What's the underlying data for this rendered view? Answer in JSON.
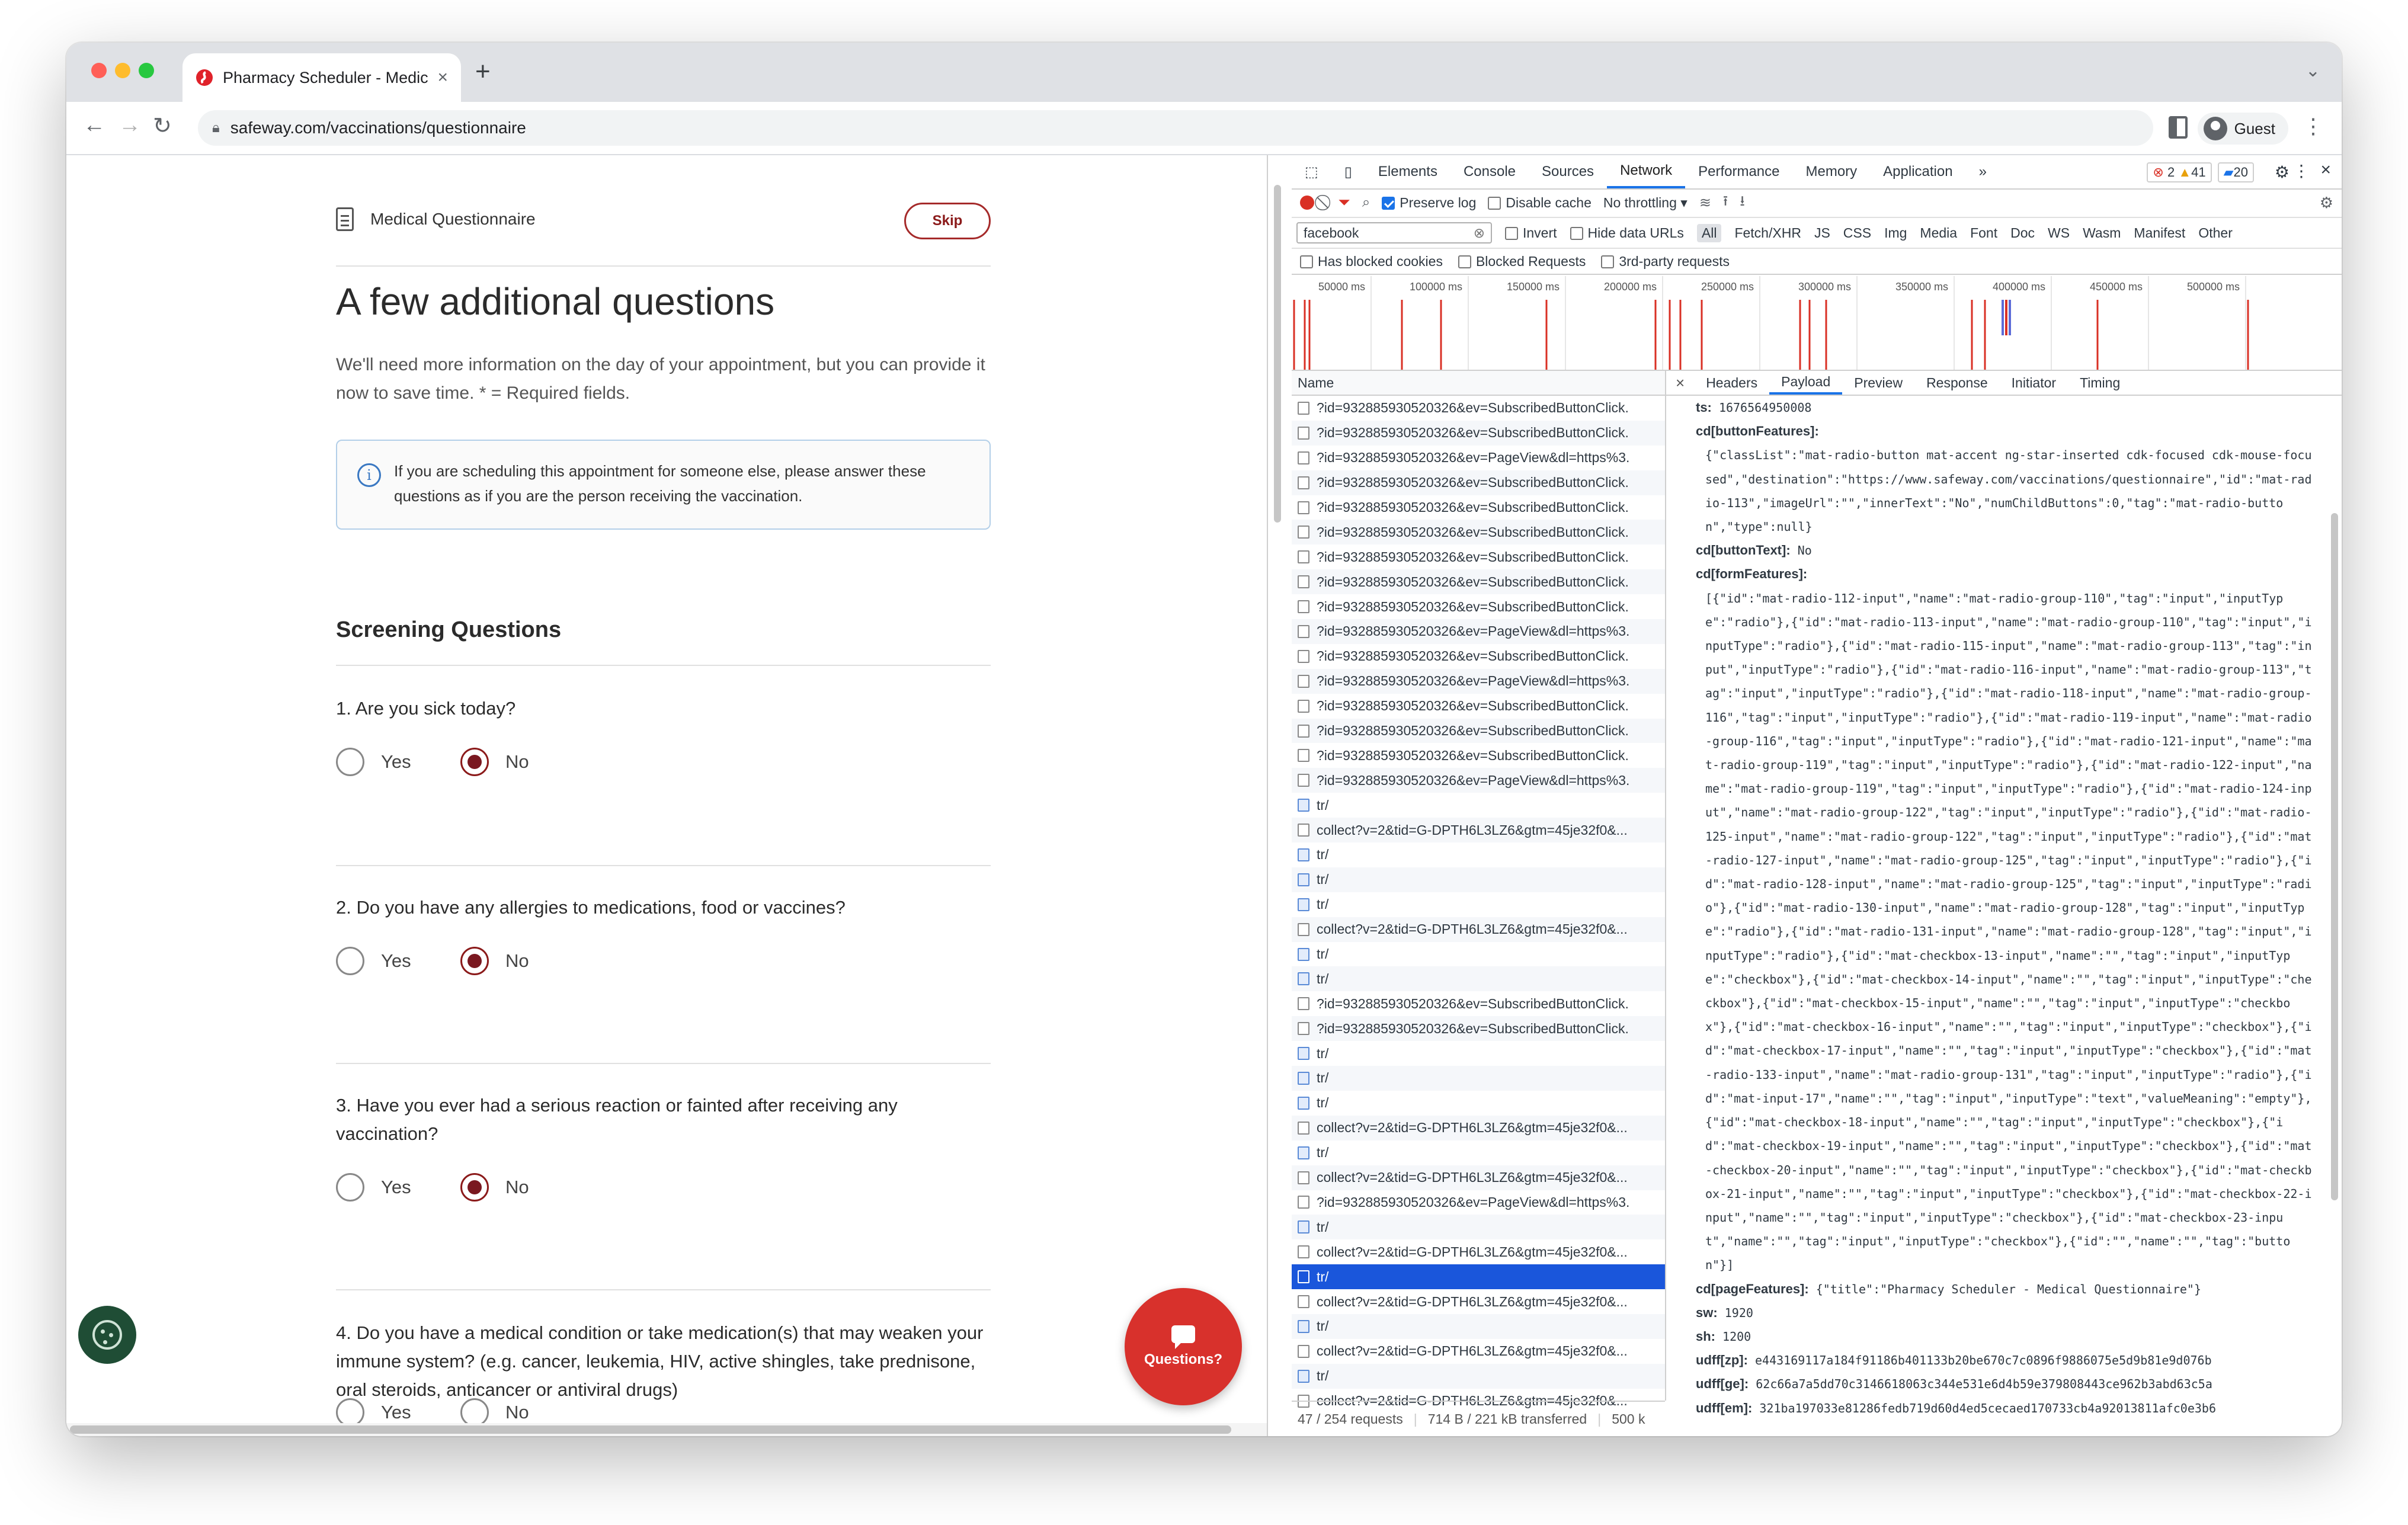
{
  "browser": {
    "tab_title": "Pharmacy Scheduler - Medical",
    "url": "safeway.com/vaccinations/questionnaire",
    "profile_label": "Guest"
  },
  "page": {
    "header_label": "Medical Questionnaire",
    "skip_label": "Skip",
    "title": "A few additional questions",
    "intro": "We'll need more information on the day of your appointment, but you can provide it now to save time. * = Required fields.",
    "info_text": "If you are scheduling this appointment for someone else, please answer these questions as if you are the person receiving the vaccination.",
    "section_title": "Screening Questions",
    "yes_label": "Yes",
    "no_label": "No",
    "questions": [
      {
        "text": "1. Are you sick today?",
        "selected": "No"
      },
      {
        "text": "2. Do you have any allergies to medications, food or vaccines?",
        "selected": "No"
      },
      {
        "text": "3. Have you ever had a serious reaction or fainted after receiving any vaccination?",
        "selected": "No"
      },
      {
        "text": "4. Do you have a medical condition or take medication(s) that may weaken your immune system? (e.g. cancer, leukemia, HIV, active shingles, take prednisone, oral steroids, anticancer or antiviral drugs)",
        "selected": ""
      }
    ],
    "questions_button_label": "Questions?",
    "accent_color": "#7a1820",
    "questions_button_color": "#d8312c"
  },
  "devtools": {
    "tabs": [
      "Elements",
      "Console",
      "Sources",
      "Network",
      "Performance",
      "Memory",
      "Application"
    ],
    "active_tab": "Network",
    "more_tabs": "»",
    "errors_count": "2",
    "warnings_count": "41",
    "messages_count": "20",
    "preserve_log_label": "Preserve log",
    "disable_cache_label": "Disable cache",
    "throttling_label": "No throttling",
    "filter_value": "facebook",
    "invert_label": "Invert",
    "hide_data_urls_label": "Hide data URLs",
    "type_filters": [
      "All",
      "Fetch/XHR",
      "JS",
      "CSS",
      "Img",
      "Media",
      "Font",
      "Doc",
      "WS",
      "Wasm",
      "Manifest",
      "Other"
    ],
    "has_blocked_cookies_label": "Has blocked cookies",
    "blocked_requests_label": "Blocked Requests",
    "third_party_label": "3rd-party requests",
    "timeline_ticks": [
      "50000 ms",
      "100000 ms",
      "150000 ms",
      "200000 ms",
      "250000 ms",
      "300000 ms",
      "350000 ms",
      "400000 ms",
      "450000 ms",
      "500000 ms"
    ],
    "name_header": "Name",
    "requests": [
      {
        "name": "?id=932885930520326&ev=SubscribedButtonClick.",
        "type": "img"
      },
      {
        "name": "?id=932885930520326&ev=SubscribedButtonClick.",
        "type": "img"
      },
      {
        "name": "?id=932885930520326&ev=PageView&dl=https%3.",
        "type": "img"
      },
      {
        "name": "?id=932885930520326&ev=SubscribedButtonClick.",
        "type": "img"
      },
      {
        "name": "?id=932885930520326&ev=SubscribedButtonClick.",
        "type": "img"
      },
      {
        "name": "?id=932885930520326&ev=SubscribedButtonClick.",
        "type": "img"
      },
      {
        "name": "?id=932885930520326&ev=SubscribedButtonClick.",
        "type": "img"
      },
      {
        "name": "?id=932885930520326&ev=SubscribedButtonClick.",
        "type": "img"
      },
      {
        "name": "?id=932885930520326&ev=SubscribedButtonClick.",
        "type": "img"
      },
      {
        "name": "?id=932885930520326&ev=PageView&dl=https%3.",
        "type": "img"
      },
      {
        "name": "?id=932885930520326&ev=SubscribedButtonClick.",
        "type": "img"
      },
      {
        "name": "?id=932885930520326&ev=PageView&dl=https%3.",
        "type": "img"
      },
      {
        "name": "?id=932885930520326&ev=SubscribedButtonClick.",
        "type": "img"
      },
      {
        "name": "?id=932885930520326&ev=SubscribedButtonClick.",
        "type": "img"
      },
      {
        "name": "?id=932885930520326&ev=SubscribedButtonClick.",
        "type": "img"
      },
      {
        "name": "?id=932885930520326&ev=PageView&dl=https%3.",
        "type": "img"
      },
      {
        "name": "tr/",
        "type": "doc"
      },
      {
        "name": "collect?v=2&tid=G-DPTH6L3LZ6&gtm=45je32f0&...",
        "type": "img"
      },
      {
        "name": "tr/",
        "type": "doc"
      },
      {
        "name": "tr/",
        "type": "doc"
      },
      {
        "name": "tr/",
        "type": "doc"
      },
      {
        "name": "collect?v=2&tid=G-DPTH6L3LZ6&gtm=45je32f0&...",
        "type": "img"
      },
      {
        "name": "tr/",
        "type": "doc"
      },
      {
        "name": "tr/",
        "type": "doc"
      },
      {
        "name": "?id=932885930520326&ev=SubscribedButtonClick.",
        "type": "img"
      },
      {
        "name": "?id=932885930520326&ev=SubscribedButtonClick.",
        "type": "img"
      },
      {
        "name": "tr/",
        "type": "doc"
      },
      {
        "name": "tr/",
        "type": "doc"
      },
      {
        "name": "tr/",
        "type": "doc"
      },
      {
        "name": "collect?v=2&tid=G-DPTH6L3LZ6&gtm=45je32f0&...",
        "type": "img"
      },
      {
        "name": "tr/",
        "type": "doc"
      },
      {
        "name": "collect?v=2&tid=G-DPTH6L3LZ6&gtm=45je32f0&...",
        "type": "img"
      },
      {
        "name": "?id=932885930520326&ev=PageView&dl=https%3.",
        "type": "img"
      },
      {
        "name": "tr/",
        "type": "doc"
      },
      {
        "name": "collect?v=2&tid=G-DPTH6L3LZ6&gtm=45je32f0&...",
        "type": "img"
      },
      {
        "name": "tr/",
        "type": "doc",
        "selected": true
      },
      {
        "name": "collect?v=2&tid=G-DPTH6L3LZ6&gtm=45je32f0&...",
        "type": "img"
      },
      {
        "name": "tr/",
        "type": "doc"
      },
      {
        "name": "collect?v=2&tid=G-DPTH6L3LZ6&gtm=45je32f0&...",
        "type": "img"
      },
      {
        "name": "tr/",
        "type": "doc"
      },
      {
        "name": "collect?v=2&tid=G-DPTH6L3LZ6&gtm=45je32f0&...",
        "type": "img"
      }
    ],
    "status": {
      "requests": "47 / 254 requests",
      "transferred": "714 B / 221 kB transferred",
      "resources": "500 k"
    },
    "detail_tabs": [
      "Headers",
      "Payload",
      "Preview",
      "Response",
      "Initiator",
      "Timing"
    ],
    "active_detail_tab": "Payload",
    "payload": {
      "ts_key": "ts:",
      "ts_val": "1676564950008",
      "button_features_key": "cd[buttonFeatures]:",
      "button_features_val": "{\"classList\":\"mat-radio-button mat-accent ng-star-inserted cdk-focused cdk-mouse-focused\",\"destination\":\"https://www.safeway.com/vaccinations/questionnaire\",\"id\":\"mat-radio-113\",\"imageUrl\":\"\",\"innerText\":\"No\",\"numChildButtons\":0,\"tag\":\"mat-radio-button\",\"type\":null}",
      "button_text_key": "cd[buttonText]:",
      "button_text_val": "No",
      "form_features_key": "cd[formFeatures]:",
      "form_features_val": "[{\"id\":\"mat-radio-112-input\",\"name\":\"mat-radio-group-110\",\"tag\":\"input\",\"inputType\":\"radio\"},{\"id\":\"mat-radio-113-input\",\"name\":\"mat-radio-group-110\",\"tag\":\"input\",\"inputType\":\"radio\"},{\"id\":\"mat-radio-115-input\",\"name\":\"mat-radio-group-113\",\"tag\":\"input\",\"inputType\":\"radio\"},{\"id\":\"mat-radio-116-input\",\"name\":\"mat-radio-group-113\",\"tag\":\"input\",\"inputType\":\"radio\"},{\"id\":\"mat-radio-118-input\",\"name\":\"mat-radio-group-116\",\"tag\":\"input\",\"inputType\":\"radio\"},{\"id\":\"mat-radio-119-input\",\"name\":\"mat-radio-group-116\",\"tag\":\"input\",\"inputType\":\"radio\"},{\"id\":\"mat-radio-121-input\",\"name\":\"mat-radio-group-119\",\"tag\":\"input\",\"inputType\":\"radio\"},{\"id\":\"mat-radio-122-input\",\"name\":\"mat-radio-group-119\",\"tag\":\"input\",\"inputType\":\"radio\"},{\"id\":\"mat-radio-124-input\",\"name\":\"mat-radio-group-122\",\"tag\":\"input\",\"inputType\":\"radio\"},{\"id\":\"mat-radio-125-input\",\"name\":\"mat-radio-group-122\",\"tag\":\"input\",\"inputType\":\"radio\"},{\"id\":\"mat-radio-127-input\",\"name\":\"mat-radio-group-125\",\"tag\":\"input\",\"inputType\":\"radio\"},{\"id\":\"mat-radio-128-input\",\"name\":\"mat-radio-group-125\",\"tag\":\"input\",\"inputType\":\"radio\"},{\"id\":\"mat-radio-130-input\",\"name\":\"mat-radio-group-128\",\"tag\":\"input\",\"inputType\":\"radio\"},{\"id\":\"mat-radio-131-input\",\"name\":\"mat-radio-group-128\",\"tag\":\"input\",\"inputType\":\"radio\"},{\"id\":\"mat-checkbox-13-input\",\"name\":\"\",\"tag\":\"input\",\"inputType\":\"checkbox\"},{\"id\":\"mat-checkbox-14-input\",\"name\":\"\",\"tag\":\"input\",\"inputType\":\"checkbox\"},{\"id\":\"mat-checkbox-15-input\",\"name\":\"\",\"tag\":\"input\",\"inputType\":\"checkbox\"},{\"id\":\"mat-checkbox-16-input\",\"name\":\"\",\"tag\":\"input\",\"inputType\":\"checkbox\"},{\"id\":\"mat-checkbox-17-input\",\"name\":\"\",\"tag\":\"input\",\"inputType\":\"checkbox\"},{\"id\":\"mat-radio-133-input\",\"name\":\"mat-radio-group-131\",\"tag\":\"input\",\"inputType\":\"radio\"},{\"id\":\"mat-input-17\",\"name\":\"\",\"tag\":\"input\",\"inputType\":\"text\",\"valueMeaning\":\"empty\"},{\"id\":\"mat-checkbox-18-input\",\"name\":\"\",\"tag\":\"input\",\"inputType\":\"checkbox\"},{\"id\":\"mat-checkbox-19-input\",\"name\":\"\",\"tag\":\"input\",\"inputType\":\"checkbox\"},{\"id\":\"mat-checkbox-20-input\",\"name\":\"\",\"tag\":\"input\",\"inputType\":\"checkbox\"},{\"id\":\"mat-checkbox-21-input\",\"name\":\"\",\"tag\":\"input\",\"inputType\":\"checkbox\"},{\"id\":\"mat-checkbox-22-input\",\"name\":\"\",\"tag\":\"input\",\"inputType\":\"checkbox\"},{\"id\":\"mat-checkbox-23-input\",\"name\":\"\",\"tag\":\"input\",\"inputType\":\"checkbox\"},{\"id\":\"\",\"name\":\"\",\"tag\":\"button\"}]",
      "page_features_key": "cd[pageFeatures]:",
      "page_features_val": "{\"title\":\"Pharmacy Scheduler - Medical Questionnaire\"}",
      "sw_key": "sw:",
      "sw_val": "1920",
      "sh_key": "sh:",
      "sh_val": "1200",
      "udff_zp_key": "udff[zp]:",
      "udff_zp_val": "e443169117a184f91186b401133b20be670c7c0896f9886075e5d9b81e9d076b",
      "udff_ge_key": "udff[ge]:",
      "udff_ge_val": "62c66a7a5dd70c3146618063c344e531e6d4b59e379808443ce962b3abd63c5a",
      "udff_em_key": "udff[em]:",
      "udff_em_val": "321ba197033e81286fedb719d60d4ed5cecaed170733cb4a92013811afc0e3b6"
    }
  }
}
